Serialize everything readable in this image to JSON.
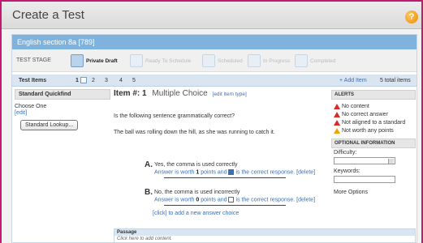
{
  "window": {
    "title": "Create a Test",
    "help_label": "?"
  },
  "section": {
    "heading": "English section 8a [789]"
  },
  "stages": {
    "label": "TEST STAGE",
    "items": [
      {
        "label": "Private Draft",
        "active": true
      },
      {
        "label": "Ready To Schedule",
        "active": false
      },
      {
        "label": "Scheduled",
        "active": false
      },
      {
        "label": "In Progress",
        "active": false
      },
      {
        "label": "Completed",
        "active": false
      }
    ]
  },
  "itembar": {
    "label": "Test Items",
    "pages": [
      "1",
      "2",
      "3",
      "4",
      "5"
    ],
    "add_label": "+ Add Item",
    "total_label": "5 total items"
  },
  "left": {
    "quickfind_title": "Standard Quickfind",
    "choose_label": "Choose One",
    "edit_label": "[edit]",
    "lookup_button": "Standard Lookup..."
  },
  "item": {
    "number_label": "Item #: 1",
    "type_label": "Multiple Choice",
    "edit_type_link": "[edit item type]",
    "question": "Is the following sentence grammatically correct?",
    "passage_sentence": "The ball was rolling down the hill, as she was running to catch it.",
    "answers": [
      {
        "letter": "A.",
        "text": "Yes, the comma is used correctly",
        "worth_prefix": "Answer is worth",
        "points": "1",
        "points_suffix": "points and",
        "correct_suffix": "is the correct response.",
        "delete_link": "[delete]",
        "checked": true
      },
      {
        "letter": "B.",
        "text": "No, the comma is used incorrectly",
        "worth_prefix": "Answer is worth",
        "points": "0",
        "points_suffix": "points and",
        "correct_suffix": "is the correct response.",
        "delete_link": "[delete]",
        "checked": false
      }
    ],
    "add_choice_link": "[click]",
    "add_choice_text": "to add a new answer choice"
  },
  "alerts": {
    "title": "ALERTS",
    "items": [
      {
        "text": "No content",
        "level": "error"
      },
      {
        "text": "No correct answer",
        "level": "error"
      },
      {
        "text": "Not aligned to a standard",
        "level": "error"
      },
      {
        "text": "Not worth any points",
        "level": "warning"
      }
    ]
  },
  "optional": {
    "title": "OPTIONAL INFORMATION",
    "difficulty_label": "Difficulty:",
    "keywords_label": "Keywords:",
    "more_label": "More Options"
  },
  "passage": {
    "title": "Passage",
    "placeholder": "Click here to add content."
  },
  "colors": {
    "accent": "#7fb2dc",
    "error": "#d92b2b",
    "warning": "#f0a400",
    "frame": "#c01a73"
  }
}
